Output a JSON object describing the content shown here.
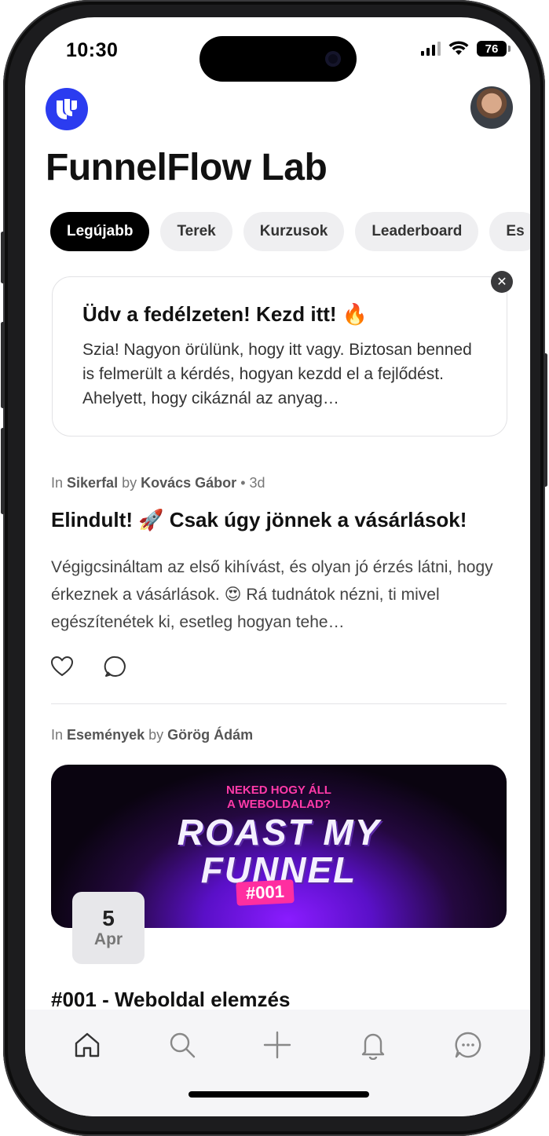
{
  "status_bar": {
    "time": "10:30",
    "battery": "76"
  },
  "header": {
    "title": "FunnelFlow Lab"
  },
  "tabs": [
    {
      "label": "Legújabb"
    },
    {
      "label": "Terek"
    },
    {
      "label": "Kurzusok"
    },
    {
      "label": "Leaderboard"
    },
    {
      "label": "Es"
    }
  ],
  "welcome_card": {
    "title": "Üdv a fedélzeten! Kezd itt! 🔥",
    "body": "Szia! Nagyon örülünk, hogy itt vagy. Biztosan benned is felmerült a kérdés, hogyan kezdd el a fejlődést. Ahelyett, hogy cikáznál az anyag…"
  },
  "post": {
    "in_label": "In",
    "space": "Sikerfal",
    "by_label": "by",
    "author": "Kovács Gábor",
    "time": "3d",
    "title": "Elindult! 🚀 Csak úgy jönnek a vásárlások!",
    "body": "Végigcsináltam az első kihívást, és olyan jó érzés látni, hogy érkeznek a vásárlások. 😍 Rá tudnátok nézni, ti mivel egészítenétek ki, esetleg hogyan tehe…"
  },
  "event_post": {
    "in_label": "In",
    "space": "Események",
    "by_label": "by",
    "author": "Görög Ádám",
    "banner_subtitle_1": "NEKED HOGY ÁLL",
    "banner_subtitle_2": "A WEBOLDALAD?",
    "banner_title_1": "ROAST MY",
    "banner_title_2": "FUNNEL",
    "banner_tag": "#001",
    "date_day": "5",
    "date_month": "Apr",
    "title": "#001 - Weboldal elemzés"
  },
  "bottom_nav": [
    "home-icon",
    "search-icon",
    "plus-icon",
    "bell-icon",
    "chat-icon"
  ],
  "colors": {
    "brand": "#2b3cf0",
    "accent_pink": "#ff2ea0",
    "banner_purple": "#8a1cff"
  }
}
